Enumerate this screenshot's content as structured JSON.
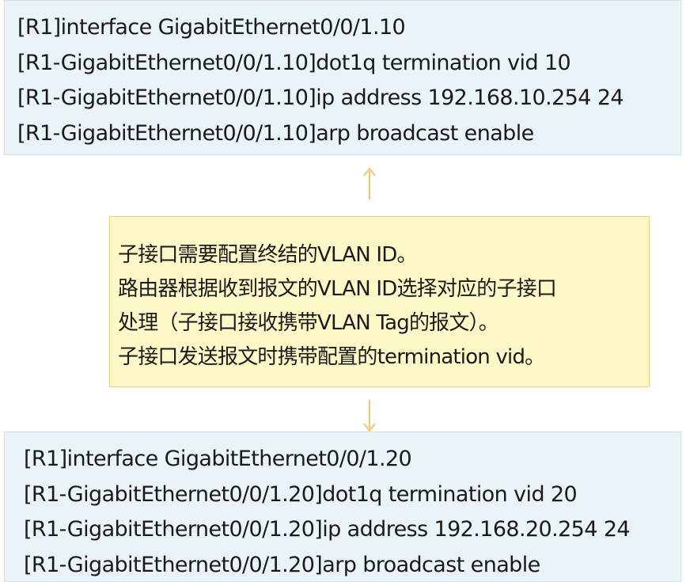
{
  "top_config": {
    "lines": [
      "[R1]interface GigabitEthernet0/0/1.10",
      "[R1-GigabitEthernet0/0/1.10]dot1q termination vid 10",
      "[R1-GigabitEthernet0/0/1.10]ip address 192.168.10.254 24",
      "[R1-GigabitEthernet0/0/1.10]arp broadcast enable"
    ]
  },
  "note": {
    "lines": [
      "子接口需要配置终结的VLAN ID。",
      "路由器根据收到报文的VLAN ID选择对应的子接口",
      "处理（子接口接收携带VLAN Tag的报文）。",
      "子接口发送报文时携带配置的termination vid。"
    ]
  },
  "bottom_config": {
    "lines": [
      "[R1]interface GigabitEthernet0/0/1.20",
      "[R1-GigabitEthernet0/0/1.20]dot1q termination vid 20",
      "[R1-GigabitEthernet0/0/1.20]ip address 192.168.20.254 24",
      "[R1-GigabitEthernet0/0/1.20]arp broadcast enable"
    ]
  },
  "colors": {
    "code_bg": "#eaf3f8",
    "code_border": "#cfe2ec",
    "note_bg": "#fef8c8",
    "note_border": "#f0cd7c",
    "arrow": "#f3c46a"
  }
}
